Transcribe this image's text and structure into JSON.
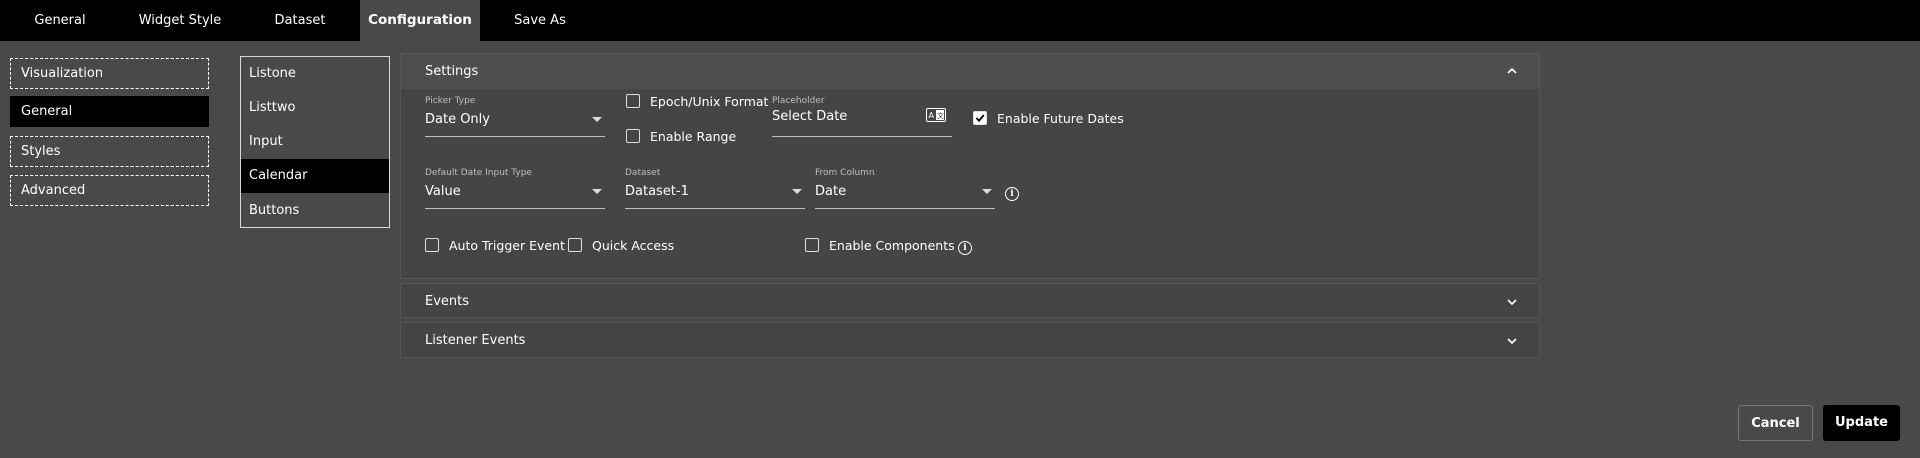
{
  "tabs": [
    {
      "label": "General"
    },
    {
      "label": "Widget Style"
    },
    {
      "label": "Dataset"
    },
    {
      "label": "Configuration",
      "active": true
    },
    {
      "label": "Save As"
    }
  ],
  "left_nav": [
    {
      "label": "Visualization"
    },
    {
      "label": "General",
      "active": true
    },
    {
      "label": "Styles"
    },
    {
      "label": "Advanced"
    }
  ],
  "components": [
    {
      "label": "Listone"
    },
    {
      "label": "Listtwo"
    },
    {
      "label": "Input"
    },
    {
      "label": "Calendar",
      "active": true
    },
    {
      "label": "Buttons"
    }
  ],
  "settings": {
    "title": "Settings",
    "picker_type": {
      "label": "Picker Type",
      "value": "Date Only"
    },
    "epoch_format": {
      "label": "Epoch/Unix Format",
      "checked": false
    },
    "enable_range": {
      "label": "Enable Range",
      "checked": false
    },
    "placeholder": {
      "label": "Placeholder",
      "value": "Select Date"
    },
    "enable_future_dates": {
      "label": "Enable Future Dates",
      "checked": true
    },
    "default_input_type": {
      "label": "Default Date Input Type",
      "value": "Value"
    },
    "dataset": {
      "label": "Dataset",
      "value": "Dataset-1"
    },
    "from_column": {
      "label": "From Column",
      "value": "Date"
    },
    "auto_trigger_event": {
      "label": "Auto Trigger Event",
      "checked": false
    },
    "quick_access": {
      "label": "Quick Access",
      "checked": false
    },
    "enable_components": {
      "label": "Enable Components",
      "checked": false
    }
  },
  "events": {
    "title": "Events"
  },
  "listener_events": {
    "title": "Listener Events"
  },
  "footer": {
    "cancel_label": "Cancel",
    "update_label": "Update"
  },
  "colors": {
    "background": "#4a4949",
    "topbar": "#000000",
    "active_item": "#000000",
    "panel": "#464545"
  }
}
